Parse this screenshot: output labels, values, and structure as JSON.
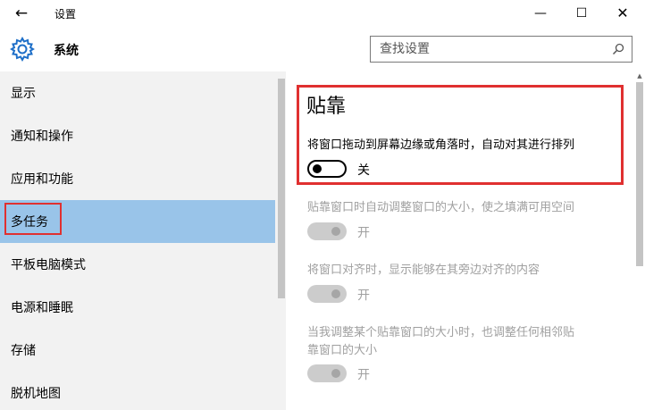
{
  "window": {
    "title": "设置",
    "back_glyph": "←",
    "min_glyph": "—",
    "max_glyph": "☐",
    "close_glyph": "✕"
  },
  "header": {
    "title": "系统",
    "icon": "gear-icon"
  },
  "search": {
    "placeholder": "查找设置",
    "icon": "search-icon"
  },
  "sidebar": {
    "items": [
      {
        "label": "显示"
      },
      {
        "label": "通知和操作"
      },
      {
        "label": "应用和功能"
      },
      {
        "label": "多任务",
        "selected": true
      },
      {
        "label": "平板电脑模式"
      },
      {
        "label": "电源和睡眠"
      },
      {
        "label": "存储"
      },
      {
        "label": "脱机地图"
      }
    ]
  },
  "snap": {
    "heading": "贴靠",
    "main_desc": "将窗口拖动到屏幕边缘或角落时，自动对其进行排列",
    "main_toggle_state": "关",
    "options": [
      {
        "desc_line1": "贴靠窗口时自动调整窗口的大小，使之填满可用空间",
        "desc_line2": "",
        "state": "开"
      },
      {
        "desc_line1": "将窗口对齐时，显示能够在其旁边对齐的内容",
        "desc_line2": "",
        "state": "开"
      },
      {
        "desc_line1": "当我调整某个贴靠窗口的大小时，也调整任何相邻贴",
        "desc_line2": "靠窗口的大小",
        "state": "开"
      }
    ]
  },
  "colors": {
    "selected_nav": "#99c4e9",
    "highlight_border": "#e03030",
    "sidebar_bg": "#f2f2f2",
    "disabled_text": "#a0a0a0"
  }
}
